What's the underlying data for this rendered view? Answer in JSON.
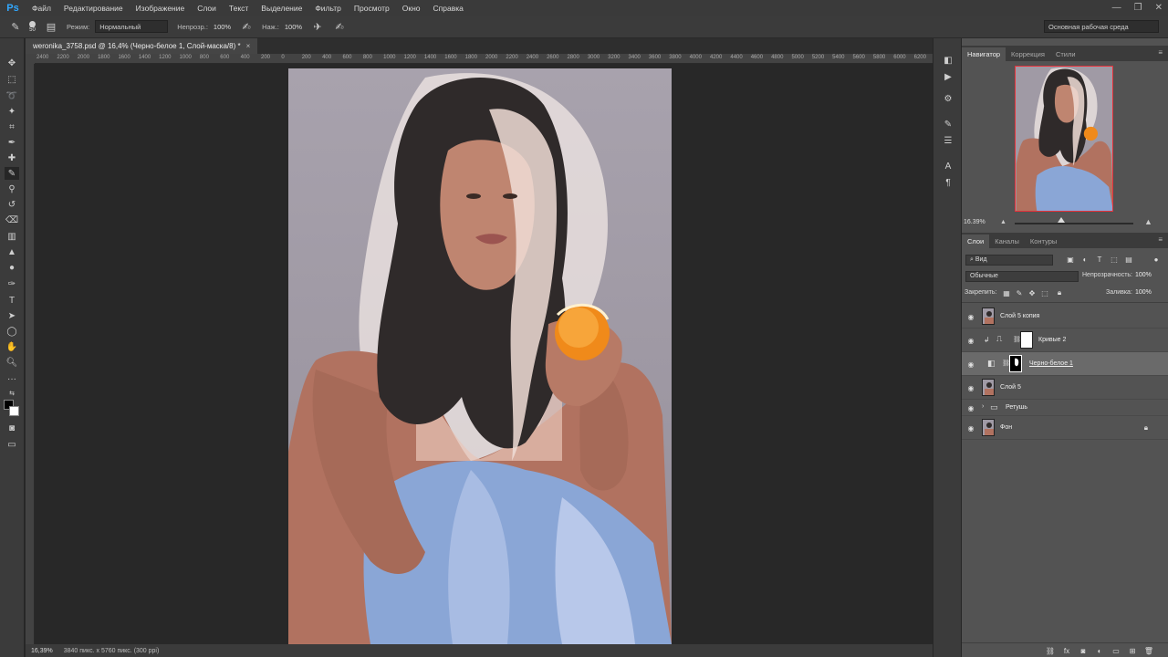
{
  "menubar": {
    "logo": "Ps",
    "items": [
      "Файл",
      "Редактирование",
      "Изображение",
      "Слои",
      "Текст",
      "Выделение",
      "Фильтр",
      "Просмотр",
      "Окно",
      "Справка"
    ],
    "window_controls": [
      "—",
      "❐",
      "✕"
    ]
  },
  "options": {
    "brush_size": "50",
    "mode_label": "Режим:",
    "mode_value": "Нормальный",
    "opacity_label": "Непрозр.:",
    "opacity_value": "100%",
    "flow_label": "Наж.:",
    "flow_value": "100%",
    "workspace": "Основная рабочая среда"
  },
  "document": {
    "tab_title": "weronika_3758.psd @ 16,4% (Черно-белое 1, Слой-маска/8) *",
    "close": "×",
    "zoom": "16,39%",
    "size_info": "3840 пикс. x 5760 пикс. (300 ppi)"
  },
  "ruler_h": [
    "2400",
    "2200",
    "2000",
    "1800",
    "1600",
    "1400",
    "1200",
    "1000",
    "800",
    "600",
    "400",
    "200",
    "0",
    "200",
    "400",
    "600",
    "800",
    "1000",
    "1200",
    "1400",
    "1600",
    "1800",
    "2000",
    "2200",
    "2400",
    "2600",
    "2800",
    "3000",
    "3200",
    "3400",
    "3600",
    "3800",
    "4000",
    "4200",
    "4400",
    "4600",
    "4800",
    "5000",
    "5200",
    "5400",
    "5600",
    "5800",
    "6000",
    "6200"
  ],
  "navigator": {
    "tabs": [
      "Навигатор",
      "Коррекция",
      "Стили"
    ],
    "zoom": "16.39%"
  },
  "layers": {
    "tabs": [
      "Слои",
      "Каналы",
      "Контуры"
    ],
    "kind": "Вид",
    "blend_mode": "Обычные",
    "opacity_label": "Непрозрачность:",
    "opacity_value": "100%",
    "lock_label": "Закрепить:",
    "fill_label": "Заливка:",
    "fill_value": "100%",
    "items": [
      {
        "name": "Слой 5 копия"
      },
      {
        "name": "Кривые 2"
      },
      {
        "name": "Черно-белое 1"
      },
      {
        "name": "Слой 5"
      },
      {
        "name": "Ретушь"
      },
      {
        "name": "Фон"
      }
    ]
  },
  "colors": {
    "accent": "#31a8ff",
    "nav_frame": "#e5313a"
  }
}
